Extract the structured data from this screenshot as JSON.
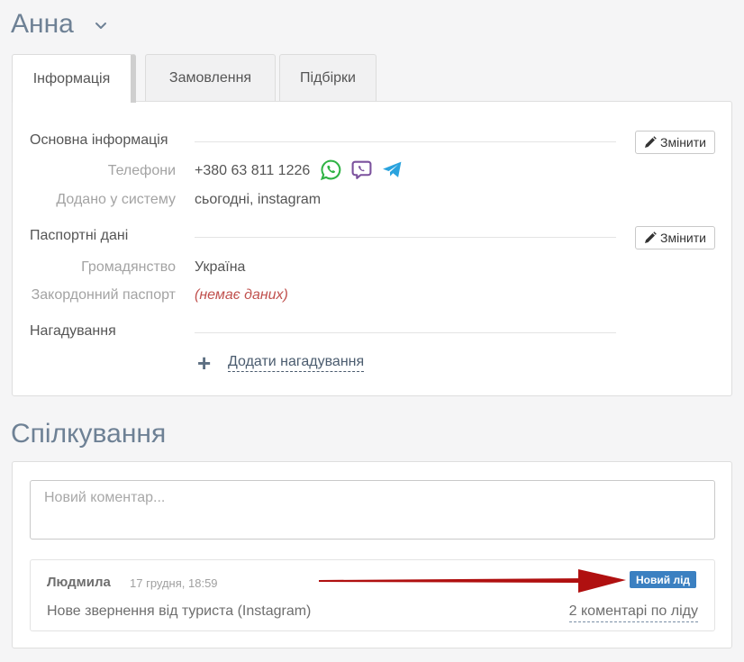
{
  "client": {
    "name": "Анна"
  },
  "tabs": [
    {
      "label": "Інформація",
      "active": true
    },
    {
      "label": "Замовлення",
      "active": false
    },
    {
      "label": "Підбірки",
      "active": false
    }
  ],
  "info": {
    "basic": {
      "title": "Основна інформація",
      "edit_label": "Змінити",
      "phones_label": "Телефони",
      "phone": "+380 63 811 1226",
      "messengers": [
        "whatsapp-icon",
        "viber-icon",
        "telegram-icon"
      ],
      "added_label": "Додано у систему",
      "added_value": "сьогодні, instagram"
    },
    "passport": {
      "title": "Паспортні дані",
      "edit_label": "Змінити",
      "citizenship_label": "Громадянство",
      "citizenship_value": "Україна",
      "foreign_passport_label": "Закордонний паспорт",
      "foreign_passport_value": "(немає даних)"
    },
    "reminders": {
      "title": "Нагадування",
      "add_label": "Додати нагадування"
    }
  },
  "communication": {
    "title": "Спілкування",
    "comment_placeholder": "Новий коментар...",
    "entry": {
      "author": "Людмила",
      "timestamp": "17 грудня, 18:59",
      "badge": "Новий лід",
      "text": "Нове звернення від туриста (Instagram)",
      "comments_link": "2 коментарі по ліду"
    }
  },
  "colors": {
    "heading": "#6e8195",
    "whatsapp": "#2fb344",
    "viber": "#7b519d",
    "telegram": "#2aa3de",
    "badge": "#3b80c1",
    "arrow": "#b01010",
    "empty_value": "#c0504d"
  }
}
